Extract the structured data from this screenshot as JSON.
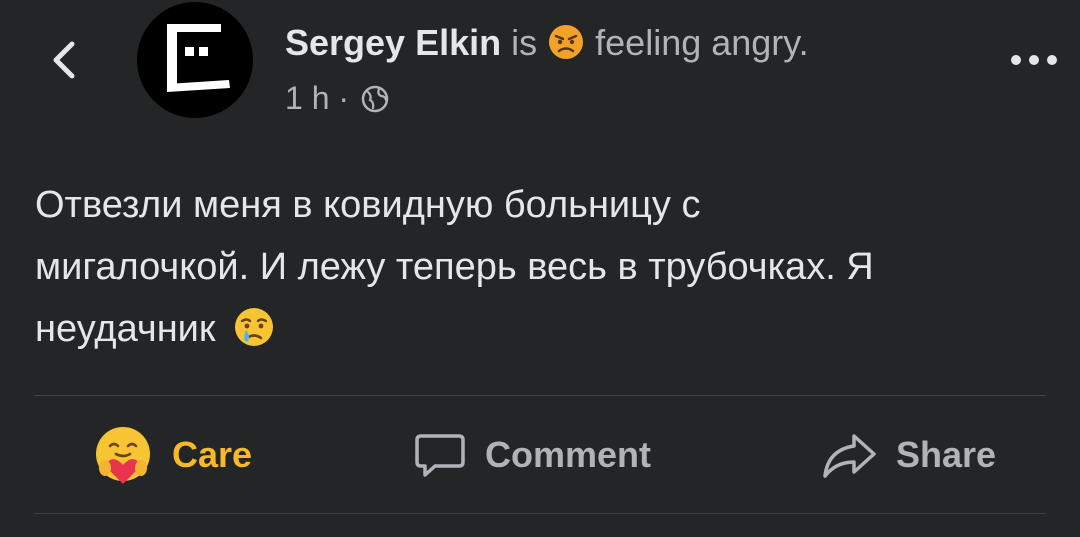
{
  "post": {
    "author_name": "Sergey Elkin",
    "is_text": "is",
    "feeling_text": "feeling angry.",
    "timestamp": "1 h",
    "separator": "·",
    "body_line1": "Отвезли меня в ковидную больницу с",
    "body_line2": "мигалочкой. И лежу теперь весь в трубочках. Я",
    "body_line3": "неудачник"
  },
  "icons": {
    "back": "chevron-left-icon",
    "avatar": "avatar",
    "feeling_emoji": "angry-face-icon",
    "audience": "globe-icon",
    "more": "more-horizontal-icon",
    "body_emoji": "crying-face-icon",
    "care": "care-reaction-icon",
    "comment": "comment-bubble-icon",
    "share": "share-arrow-icon"
  },
  "actions": {
    "care_label": "Care",
    "comment_label": "Comment",
    "share_label": "Share"
  },
  "colors": {
    "background": "#242526",
    "text_primary": "#e4e6eb",
    "text_secondary": "#b0b3b8",
    "care_active": "#f7b928",
    "divider": "#3e4042"
  }
}
